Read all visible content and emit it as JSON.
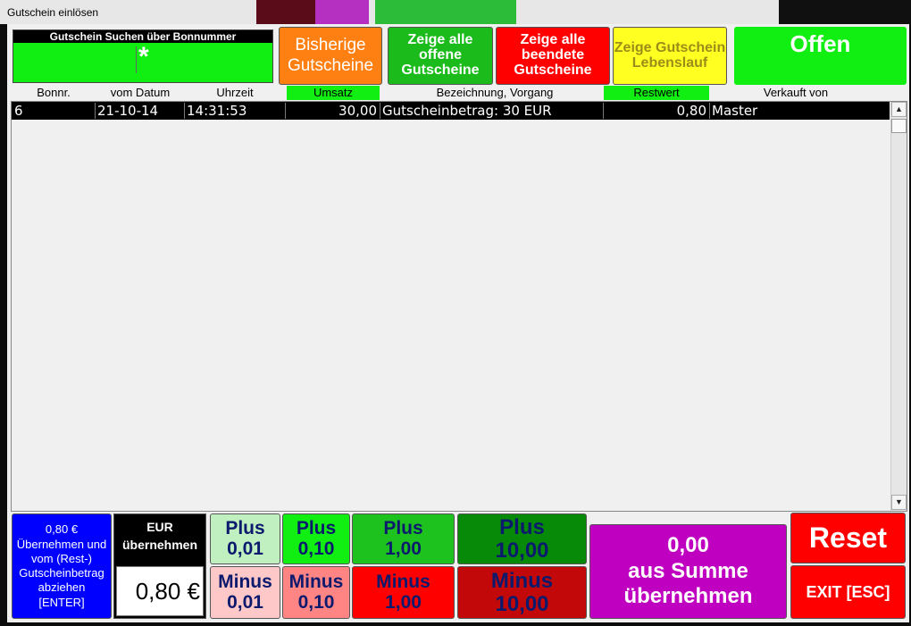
{
  "window": {
    "title": "Gutschein einlösen"
  },
  "search": {
    "label": "Gutschein Suchen über Bonnummer",
    "value": "*"
  },
  "top_buttons": {
    "previous": "Bisherige Gutscheine",
    "open": "Zeige alle offene Gutscheine",
    "closed": "Zeige alle beendete Gutscheine",
    "history": "Zeige Gutschein Lebenslauf",
    "status": "Offen"
  },
  "table": {
    "headers": [
      "Bonnr.",
      "vom Datum",
      "Uhrzeit",
      "Umsatz",
      "Bezeichnung, Vorgang",
      "Restwert",
      "Verkauft von"
    ],
    "rows": [
      {
        "bonnr": "6",
        "datum": "21-10-14",
        "uhrzeit": "14:31:53",
        "umsatz": "30,00",
        "bezeichnung": "Gutscheinbetrag: 30 EUR",
        "restwert": "0,80",
        "verkauft_von": "Master"
      }
    ]
  },
  "bottom": {
    "apply_rest": "0,80 € Übernehmen und vom (Rest-) Gutscheinbetrag abziehen [ENTER]",
    "eur_label": "EUR übernehmen",
    "amount": "0,80 €",
    "plus_label": "Plus",
    "minus_label": "Minus",
    "steps": [
      "0,01",
      "0,10",
      "1,00",
      "10,00"
    ],
    "sum_amount": "0,00",
    "sum_label": "aus Summe übernehmen",
    "reset": "Reset",
    "exit": "EXIT [ESC]"
  },
  "colors": {
    "green": "#11ee11",
    "orange": "#ff8012",
    "red": "#ff0000",
    "yellow": "#ffff22",
    "blue": "#0000ff",
    "purple": "#c000c0"
  }
}
